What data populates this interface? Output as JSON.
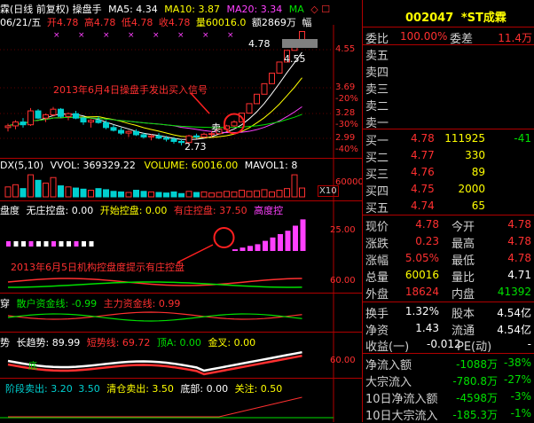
{
  "colors": {
    "up": "#ff3030",
    "down": "#00d0d0",
    "ma5": "#ffffff",
    "ma10": "#ffff00",
    "ma20": "#ff40ff",
    "ma30": "#00e000",
    "panel_border": "#b00000",
    "annotation": "#ff2020"
  },
  "main": {
    "title": "霖(日线 前复权) 操盘手",
    "ma5_label": "MA5: 4.34",
    "ma10_label": "MA10: 3.87",
    "ma20_label": "MA20: 3.34",
    "ma30_label": "MA",
    "icons_suffix": "◇ ☐",
    "info_date": "06/21/五",
    "info_open": "开4.78",
    "info_high": "高4.78",
    "info_low": "低4.78",
    "info_close": "收4.78",
    "info_vol": "量60016.0",
    "info_amt": "额2869万",
    "info_tail": "幅",
    "price_high_tag": "4.78",
    "price_prev_tag": "4.55",
    "price_low_tag": "2.73",
    "yaxis": [
      "4.55",
      "3.69",
      "-20%",
      "3.28",
      "-30%",
      "2.99",
      "-40%"
    ],
    "annotation1": "2013年6月4日操盘手发出买入信号",
    "sell_marker": "卖"
  },
  "vol_panel": {
    "title": "DX(5,10)",
    "vvol": "VVOL: 369329.22",
    "volume": "VOLUME: 60016.00",
    "mavol": "MAVOL1: 8",
    "yaxis": "60000",
    "x_label": "X10"
  },
  "control_panel": {
    "title": "盘度",
    "none": "无庄控盘: 0.00",
    "start": "开始控盘: 0.00",
    "has": "有庄控盘: 37.50",
    "high": "高度控",
    "yaxis_top": "25.00",
    "yaxis_bot": "60.00",
    "annotation2": "2013年6月5日机构控盘度提示有庄控盘"
  },
  "fund_panel": {
    "title": "穿",
    "retail": "散户资金线: -0.99",
    "main": "主力资金线: 0.99"
  },
  "trend_panel": {
    "title": "势",
    "long": "长趋势: 89.99",
    "short": "短势线: 69.72",
    "top": "顶A: 0.00",
    "gold": "金叉: 0.00",
    "yaxis": "60.00",
    "bottom_marker": "底"
  },
  "sell_panel": {
    "s1": "阶段卖出: 3.20",
    "s2": "3.50",
    "clear": "清仓卖出: 3.50",
    "bottom": "底部: 0.00",
    "focus": "关注: 0.50"
  },
  "stock": {
    "code": "002047",
    "name": "*ST成霖"
  },
  "ratio": {
    "label1": "委比",
    "v1": "100.00%",
    "label2": "委差",
    "v2": "11.4万"
  },
  "sells": [
    {
      "label": "卖五"
    },
    {
      "label": "卖四"
    },
    {
      "label": "卖三"
    },
    {
      "label": "卖二"
    },
    {
      "label": "卖一"
    }
  ],
  "buys": [
    {
      "label": "买一",
      "price": "4.78",
      "vol": "111925",
      "chg": "-41"
    },
    {
      "label": "买二",
      "price": "4.77",
      "vol": "330",
      "chg": ""
    },
    {
      "label": "买三",
      "price": "4.76",
      "vol": "89",
      "chg": ""
    },
    {
      "label": "买四",
      "price": "4.75",
      "vol": "2000",
      "chg": ""
    },
    {
      "label": "买五",
      "price": "4.74",
      "vol": "65",
      "chg": ""
    }
  ],
  "quote": [
    {
      "l1": "现价",
      "v1": "4.78",
      "l2": "今开",
      "v2": "4.78"
    },
    {
      "l1": "涨跌",
      "v1": "0.23",
      "l2": "最高",
      "v2": "4.78"
    },
    {
      "l1": "涨幅",
      "v1": "5.05%",
      "l2": "最低",
      "v2": "4.78"
    },
    {
      "l1": "总量",
      "v1": "60016",
      "l2": "量比",
      "v2": "4.71"
    },
    {
      "l1": "外盘",
      "v1": "18624",
      "l2": "内盘",
      "v2": "41392"
    }
  ],
  "stats": [
    {
      "l1": "换手",
      "v1": "1.32%",
      "l2": "股本",
      "v2": "4.54亿"
    },
    {
      "l1": "净资",
      "v1": "1.43",
      "l2": "流通",
      "v2": "4.54亿"
    }
  ],
  "earn": {
    "label": "收益(一)",
    "v": "-0.012",
    "pe": "PE(动)",
    "pev": "-"
  },
  "flows": [
    {
      "label": "净流入额",
      "v": "-1088万",
      "p": "-38%"
    },
    {
      "label": "大宗流入",
      "v": "-780.8万",
      "p": "-27%"
    },
    {
      "label": "10日净流入额",
      "v": "-4598万",
      "p": "-3%"
    },
    {
      "label": "10日大宗流入",
      "v": "-185.3万",
      "p": "-1%"
    }
  ],
  "chart_data": {
    "type": "candlestick",
    "ohlc": [
      [
        3.05,
        3.12,
        2.98,
        3.08
      ],
      [
        3.08,
        3.18,
        3.02,
        3.15
      ],
      [
        3.15,
        3.22,
        3.05,
        3.1
      ],
      [
        3.1,
        3.4,
        3.08,
        3.35
      ],
      [
        3.35,
        3.38,
        3.2,
        3.22
      ],
      [
        3.22,
        3.3,
        3.15,
        3.28
      ],
      [
        3.28,
        3.42,
        3.25,
        3.38
      ],
      [
        3.38,
        3.4,
        3.22,
        3.25
      ],
      [
        3.25,
        3.32,
        3.18,
        3.3
      ],
      [
        3.3,
        3.35,
        3.2,
        3.22
      ],
      [
        3.22,
        3.25,
        3.1,
        3.15
      ],
      [
        3.15,
        3.2,
        3.05,
        3.18
      ],
      [
        3.18,
        3.25,
        3.12,
        3.14
      ],
      [
        3.14,
        3.18,
        3.02,
        3.05
      ],
      [
        3.05,
        3.1,
        2.98,
        3.0
      ],
      [
        3.0,
        3.05,
        2.92,
        2.95
      ],
      [
        2.95,
        3.0,
        2.88,
        2.98
      ],
      [
        2.98,
        3.02,
        2.9,
        2.92
      ],
      [
        2.92,
        2.96,
        2.85,
        2.88
      ],
      [
        2.88,
        2.93,
        2.82,
        2.9
      ],
      [
        2.9,
        2.95,
        2.84,
        2.86
      ],
      [
        2.86,
        2.9,
        2.8,
        2.84
      ],
      [
        2.84,
        2.88,
        2.76,
        2.8
      ],
      [
        2.8,
        2.84,
        2.73,
        2.78
      ],
      [
        2.78,
        2.92,
        2.76,
        2.9
      ],
      [
        2.9,
        2.94,
        2.85,
        2.88
      ],
      [
        2.88,
        2.96,
        2.86,
        2.93
      ],
      [
        2.93,
        2.98,
        2.88,
        2.94
      ],
      [
        2.94,
        3.04,
        2.92,
        3.02
      ],
      [
        3.02,
        3.1,
        3.0,
        3.08
      ],
      [
        3.08,
        3.18,
        3.06,
        3.15
      ],
      [
        3.15,
        3.31,
        3.15,
        3.31
      ],
      [
        3.31,
        3.48,
        3.31,
        3.48
      ],
      [
        3.48,
        3.65,
        3.48,
        3.65
      ],
      [
        3.65,
        3.84,
        3.65,
        3.84
      ],
      [
        3.84,
        4.03,
        3.84,
        4.03
      ],
      [
        4.03,
        4.23,
        4.03,
        4.23
      ],
      [
        4.23,
        4.44,
        4.23,
        4.44
      ],
      [
        4.44,
        4.55,
        4.44,
        4.55
      ],
      [
        4.55,
        4.78,
        4.55,
        4.78
      ]
    ],
    "volume": [
      18,
      22,
      15,
      40,
      30,
      25,
      35,
      20,
      18,
      16,
      14,
      12,
      15,
      13,
      10,
      9,
      8,
      12,
      10,
      9,
      8,
      7,
      9,
      6,
      10,
      8,
      9,
      7,
      8,
      10,
      9,
      12,
      10,
      11,
      13,
      9,
      12,
      15,
      40,
      16
    ],
    "control": [
      0,
      0,
      0,
      0,
      0,
      0,
      0,
      0,
      0,
      0,
      0,
      0,
      0,
      0,
      0,
      0,
      0,
      0,
      0,
      0,
      0,
      0,
      0,
      0,
      0,
      0,
      0,
      0,
      0,
      0,
      2,
      4,
      6,
      8,
      12,
      16,
      20,
      24,
      30,
      37.5
    ]
  }
}
